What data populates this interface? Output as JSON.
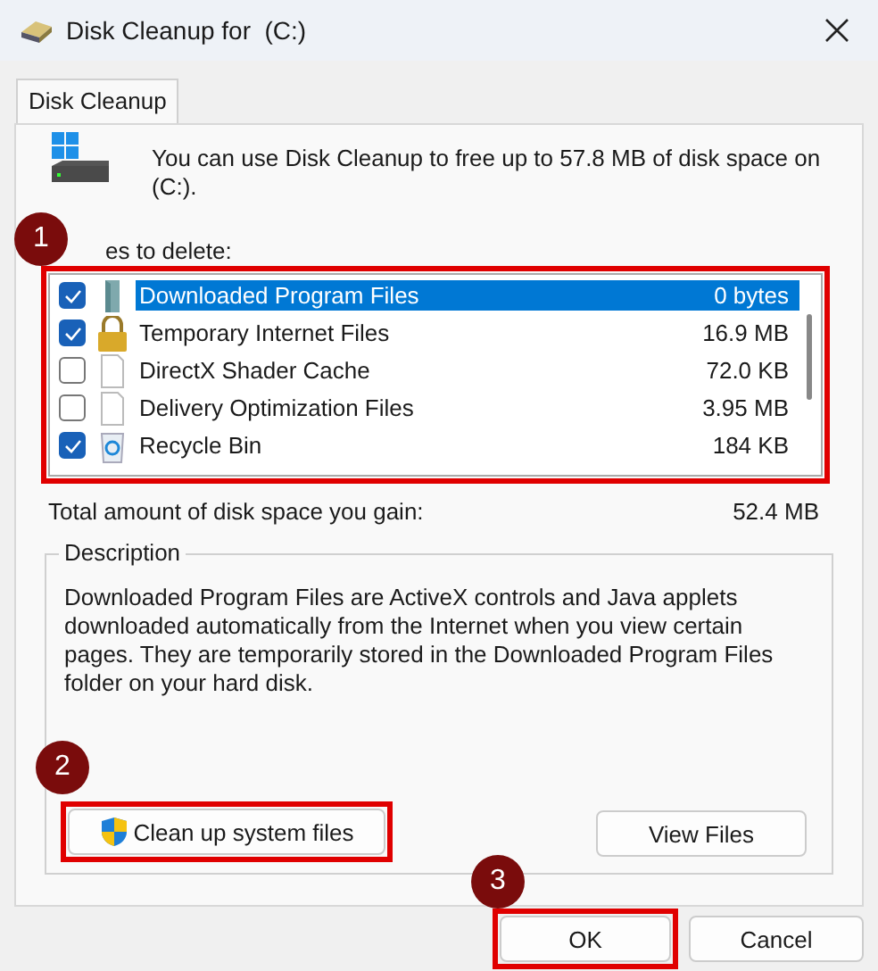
{
  "window": {
    "title": "Disk Cleanup for  (C:)"
  },
  "tabs": [
    {
      "label": "Disk Cleanup",
      "selected": true
    }
  ],
  "intro": "You can use Disk Cleanup to free up to 57.8 MB of disk space on (C:).",
  "files_label": "es to delete:",
  "files_list": {
    "highlighted": true,
    "callout": "1",
    "rows": [
      {
        "name": "Downloaded Program Files",
        "size": "0 bytes",
        "checked": true,
        "selected": true
      },
      {
        "name": "Temporary Internet Files",
        "size": "16.9 MB",
        "checked": true,
        "selected": false
      },
      {
        "name": "DirectX Shader Cache",
        "size": "72.0 KB",
        "checked": false,
        "selected": false
      },
      {
        "name": "Delivery Optimization Files",
        "size": "3.95 MB",
        "checked": false,
        "selected": false
      },
      {
        "name": "Recycle Bin",
        "size": "184 KB",
        "checked": true,
        "selected": false
      }
    ]
  },
  "total": {
    "label": "Total amount of disk space you gain:",
    "value": "52.4 MB"
  },
  "description": {
    "title": "Description",
    "text": "Downloaded Program Files are ActiveX controls and Java applets downloaded automatically from the Internet when you view certain pages. They are temporarily stored in the Downloaded Program Files folder on your hard disk."
  },
  "clean_button": {
    "label": "Clean up system files",
    "highlighted": true,
    "callout": "2"
  },
  "view_button": {
    "label": "View Files"
  },
  "ok_button": {
    "label": "OK",
    "highlighted": true,
    "callout": "3"
  },
  "cancel_button": {
    "label": "Cancel"
  }
}
